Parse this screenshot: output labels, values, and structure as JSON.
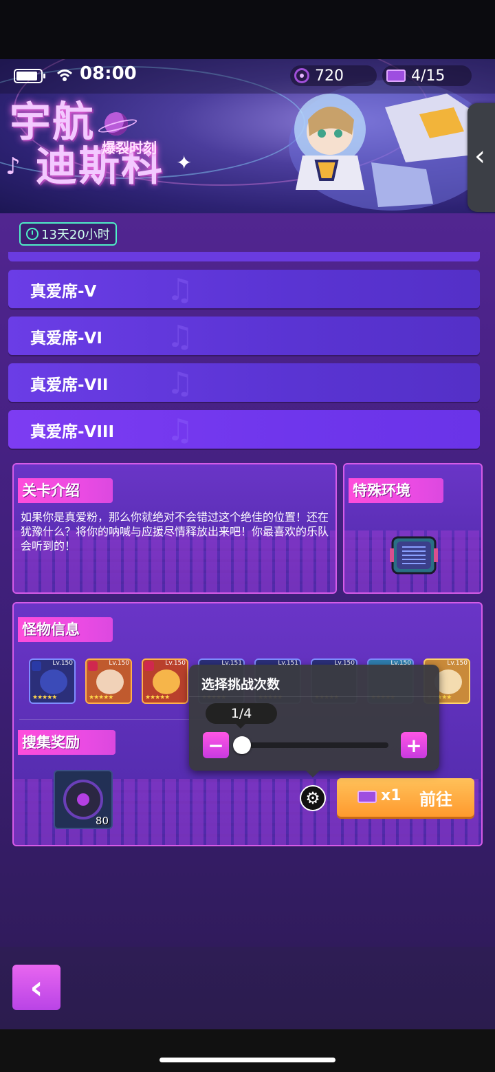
{
  "status_bar": {
    "time": "08:00"
  },
  "currency": {
    "coins": "720",
    "tickets": "4/15"
  },
  "event": {
    "title_line1": "宇航",
    "title_line2": "迪斯科",
    "subtitle": "爆裂时刻",
    "time_left": "13天20小时"
  },
  "stages": [
    {
      "label": "真爱席-V"
    },
    {
      "label": "真爱席-VI"
    },
    {
      "label": "真爱席-VII"
    },
    {
      "label": "真爱席-VIII"
    }
  ],
  "intro": {
    "title": "关卡介绍",
    "text": "如果你是真爱粉，那么你就绝对不会错过这个绝佳的位置！还在犹豫什么？将你的呐喊与应援尽情释放出来吧！你最喜欢的乐队会听到的！"
  },
  "environment": {
    "title": "特殊环境"
  },
  "monsters": {
    "title": "怪物信息",
    "list": [
      {
        "level": "Lv.150",
        "stars": "★★★★★"
      },
      {
        "level": "Lv.150",
        "stars": "★★★★★"
      },
      {
        "level": "Lv.150",
        "stars": "★★★★★"
      },
      {
        "level": "Lv.151",
        "stars": "★★★★★"
      },
      {
        "level": "Lv.151",
        "stars": "★★★★★"
      },
      {
        "level": "Lv.150",
        "stars": "★★★★★"
      },
      {
        "level": "Lv.150",
        "stars": "★★★★★"
      },
      {
        "level": "Lv.150",
        "stars": "★★★★★"
      }
    ]
  },
  "rewards": {
    "title": "搜集奖励",
    "item_qty": "80"
  },
  "challenge_popup": {
    "title": "选择挑战次数",
    "count": "1/4",
    "value_fraction": 0.0,
    "minus": "−",
    "plus": "+"
  },
  "go_button": {
    "cost": "x1",
    "label": "前往"
  },
  "colors": {
    "accent_pink": "#e94be3",
    "go_orange": "#ff9a2e",
    "timer_teal": "#4ff0c7"
  }
}
